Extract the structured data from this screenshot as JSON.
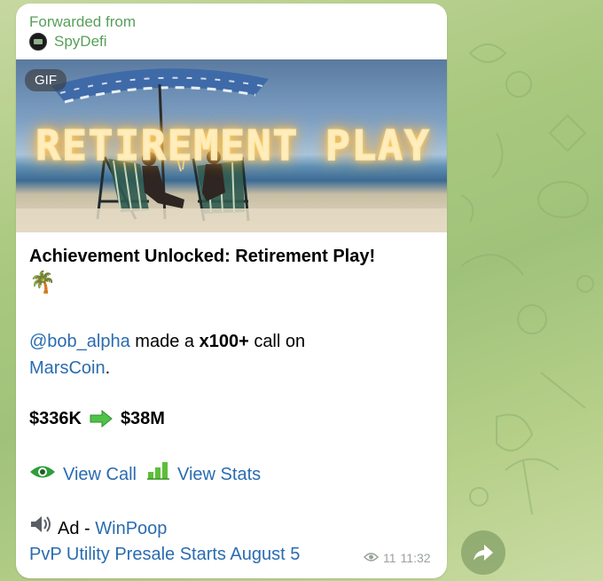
{
  "message": {
    "forwarded_label": "Forwarded from",
    "source_name": "SpyDefi",
    "media": {
      "badge": "GIF",
      "overlay_text": "RETIREMENT PLAY"
    },
    "title": "Achievement Unlocked: Retirement Play!",
    "title_emoji": "🌴",
    "call": {
      "user": "@bob_alpha",
      "text_before": "made a",
      "multiplier": "x100+",
      "text_after": "call on",
      "coin": "MarsCoin",
      "coin_suffix": "."
    },
    "prices": {
      "from": "$336K",
      "to": "$38M"
    },
    "links": {
      "view_call": "View Call",
      "view_stats": "View Stats"
    },
    "ad": {
      "prefix": "Ad - ",
      "brand": "WinPoop",
      "line2": "PvP Utility Presale Starts August 5"
    },
    "meta": {
      "views": "11",
      "time": "11:32"
    }
  },
  "colors": {
    "forward_green": "#57a05a",
    "link_blue": "#2a6cb0",
    "arrow_green": "#4fc24a",
    "eye_green": "#2e9d3a"
  },
  "icons": {
    "eye": "eye-icon",
    "bars": "bar-chart-icon",
    "arrow": "right-arrow-icon",
    "speaker": "speaker-icon",
    "share": "share-arrow-icon",
    "views": "views-eye-icon"
  }
}
